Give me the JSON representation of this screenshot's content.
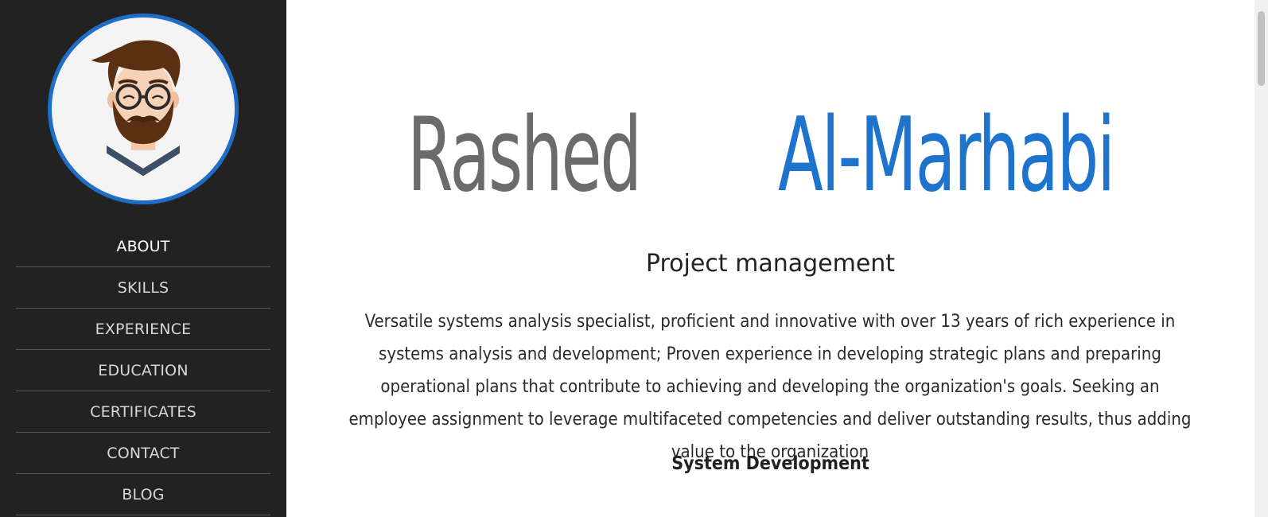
{
  "sidebar": {
    "avatar_icon": "bearded-man-avatar",
    "items": [
      {
        "label": "ABOUT",
        "active": true
      },
      {
        "label": "SKILLS",
        "active": false
      },
      {
        "label": "EXPERIENCE",
        "active": false
      },
      {
        "label": "EDUCATION",
        "active": false
      },
      {
        "label": "CERTIFICATES",
        "active": false
      },
      {
        "label": "CONTACT",
        "active": false
      },
      {
        "label": "BLOG",
        "active": false
      }
    ]
  },
  "hero": {
    "first_name": "Rashed",
    "last_name": "Al-Marhabi"
  },
  "about": {
    "role": "Project management",
    "summary": "Versatile systems analysis specialist, proficient and innovative with over 13 years of rich experience in systems analysis and development; Proven experience in developing strategic plans and preparing operational plans that contribute to achieving and developing the organization's goals. Seeking an employee assignment to leverage multifaceted competencies and deliver outstanding results, thus adding value to the organization",
    "subheading": "System Development"
  },
  "colors": {
    "sidebar_bg": "#222222",
    "accent": "#1e73cc",
    "name_gray": "#6b6b6b"
  }
}
